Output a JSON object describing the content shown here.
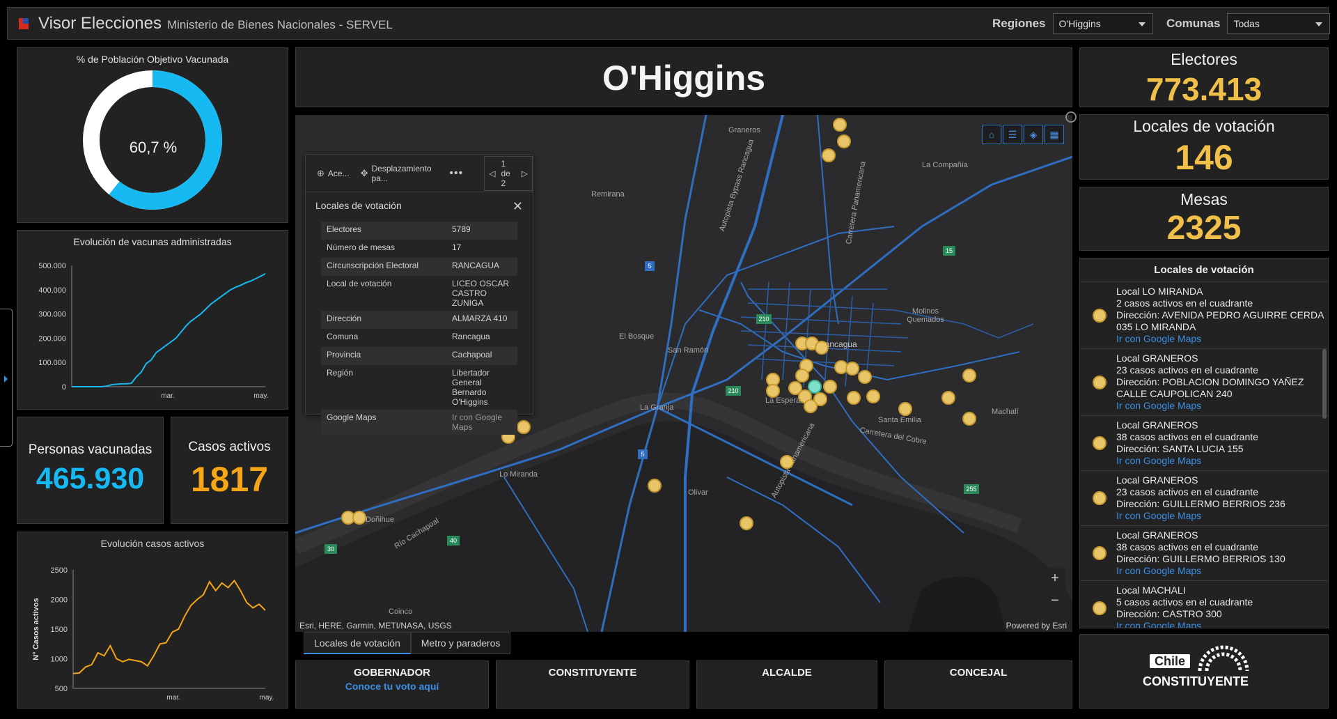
{
  "header": {
    "title": "Visor Elecciones",
    "subtitle": "Ministerio de Bienes Nacionales - SERVEL",
    "regiones_label": "Regiones",
    "regiones_value": "O'Higgins",
    "comunas_label": "Comunas",
    "comunas_value": "Todas"
  },
  "vaccination": {
    "title": "% de Población Objetivo Vacunada",
    "percent_label": "60,7 %",
    "percent": 60.7
  },
  "vaccine_chart": {
    "title": "Evolución de vacunas administradas",
    "chart_data": {
      "type": "line",
      "title": "Evolución de vacunas administradas",
      "x_tick_labels": [
        "mar.",
        "may."
      ],
      "y_tick_labels": [
        "0",
        "100.000",
        "200.000",
        "300.000",
        "400.000",
        "500.000"
      ],
      "ylim": [
        0,
        500000
      ],
      "series": [
        {
          "values": [
            0,
            0,
            0,
            0,
            0,
            0,
            0,
            2000,
            8000,
            10000,
            12000,
            12000,
            14000,
            40000,
            60000,
            95000,
            110000,
            140000,
            155000,
            170000,
            185000,
            200000,
            225000,
            250000,
            270000,
            285000,
            300000,
            320000,
            340000,
            355000,
            370000,
            385000,
            400000,
            410000,
            418000,
            428000,
            435000,
            445000,
            455000,
            465930
          ]
        }
      ],
      "color": "#16b9f2"
    }
  },
  "kpis": {
    "personas_label": "Personas vacunadas",
    "personas_value": "465.930",
    "casos_label": "Casos activos",
    "casos_value": "1817",
    "electores_label": "Electores",
    "electores_value": "773.413",
    "locales_label": "Locales de votación",
    "locales_value": "146",
    "mesas_label": "Mesas",
    "mesas_value": "2325"
  },
  "cases_chart": {
    "title": "Evolución casos activos",
    "ylabel": "N° Casos activos",
    "chart_data": {
      "type": "line",
      "title": "Evolución casos activos",
      "ylabel": "N° Casos activos",
      "x_tick_labels": [
        "mar.",
        "may."
      ],
      "y_tick_labels": [
        "500",
        "1000",
        "1500",
        "2000",
        "2500"
      ],
      "ylim": [
        500,
        2500
      ],
      "series": [
        {
          "values": [
            750,
            760,
            860,
            900,
            1100,
            1050,
            1220,
            1000,
            950,
            990,
            970,
            950,
            880,
            1050,
            1250,
            1270,
            1450,
            1500,
            1720,
            1900,
            2000,
            2080,
            2300,
            2150,
            2280,
            2200,
            2320,
            2150,
            1950,
            1860,
            1920,
            1817
          ]
        }
      ],
      "color": "#f5a515"
    }
  },
  "region_title": "O'Higgins",
  "map": {
    "places": [
      "Graneros",
      "La Compañía",
      "Remirana",
      "Rancagua",
      "El Bosque",
      "San Ramón",
      "Molinos Quemados",
      "La Esperanza",
      "Machalí",
      "Santa Emilia",
      "La Granja",
      "Carretera del Cobre",
      "Lo Miranda",
      "Olivar",
      "Doñihue",
      "Coinco",
      "Río Cachapoal",
      "Autopista Panamericana",
      "Autopista Bypass Rancagua",
      "Carretera Panamericana"
    ],
    "route_shields": [
      "5",
      "15",
      "210",
      "210",
      "5",
      "255",
      "30",
      "40"
    ],
    "attribution_left": "Esri, HERE, Garmin, METI/NASA, USGS",
    "attribution_right": "Powered by Esri",
    "zoom_in": "+",
    "zoom_out": "−"
  },
  "popup": {
    "action_zoom": "Ace...",
    "action_pan": "Desplazamiento pa...",
    "pager": "1 de 2",
    "title": "Locales de votación",
    "rows": [
      {
        "k": "Electores",
        "v": "5789"
      },
      {
        "k": "Número de mesas",
        "v": "17"
      },
      {
        "k": "Circunscripción Electoral",
        "v": "RANCAGUA"
      },
      {
        "k": "Local de votación",
        "v": "LICEO OSCAR CASTRO ZUNIGA"
      },
      {
        "k": "Dirección",
        "v": "ALMARZA 410"
      },
      {
        "k": "Comuna",
        "v": "Rancagua"
      },
      {
        "k": "Provincia",
        "v": "Cachapoal"
      },
      {
        "k": "Región",
        "v": "Libertador General Bernardo O'Higgins"
      },
      {
        "k": "Google Maps",
        "v": "Ir con Google Maps"
      }
    ]
  },
  "tabs": [
    "Locales de votación",
    "Metro y paraderos"
  ],
  "votes": [
    {
      "title": "GOBERNADOR",
      "link": "Conoce tu voto aquí"
    },
    {
      "title": "CONSTITUYENTE",
      "link": ""
    },
    {
      "title": "ALCALDE",
      "link": ""
    },
    {
      "title": "CONCEJAL",
      "link": ""
    }
  ],
  "list": {
    "title": "Locales de votación",
    "items": [
      {
        "local": "Local LO MIRANDA",
        "casos": "2 casos activos en el cuadrante",
        "dir": "Dirección: AVENIDA PEDRO AGUIRRE CERDA 035 LO MIRANDA",
        "link": "Ir con Google Maps"
      },
      {
        "local": "Local GRANEROS",
        "casos": "23 casos activos en el cuadrante",
        "dir": "Dirección: POBLACION DOMINGO YAÑEZ CALLE CAUPOLICAN 240",
        "link": "Ir con Google Maps"
      },
      {
        "local": "Local GRANEROS",
        "casos": "38 casos activos en el cuadrante",
        "dir": "Dirección: SANTA LUCIA 155",
        "link": "Ir con Google Maps"
      },
      {
        "local": "Local GRANEROS",
        "casos": "23 casos activos en el cuadrante",
        "dir": "Dirección: GUILLERMO BERRIOS 236",
        "link": "Ir con Google Maps"
      },
      {
        "local": "Local GRANEROS",
        "casos": "38 casos activos en el cuadrante",
        "dir": "Dirección: GUILLERMO BERRIOS 130",
        "link": "Ir con Google Maps"
      },
      {
        "local": "Local MACHALI",
        "casos": "5 casos activos en el cuadrante",
        "dir": "Dirección: CASTRO 300",
        "link": "Ir con Google Maps"
      }
    ]
  },
  "logo": {
    "line1": "Chile",
    "line2": "CONSTITUYENTE"
  }
}
